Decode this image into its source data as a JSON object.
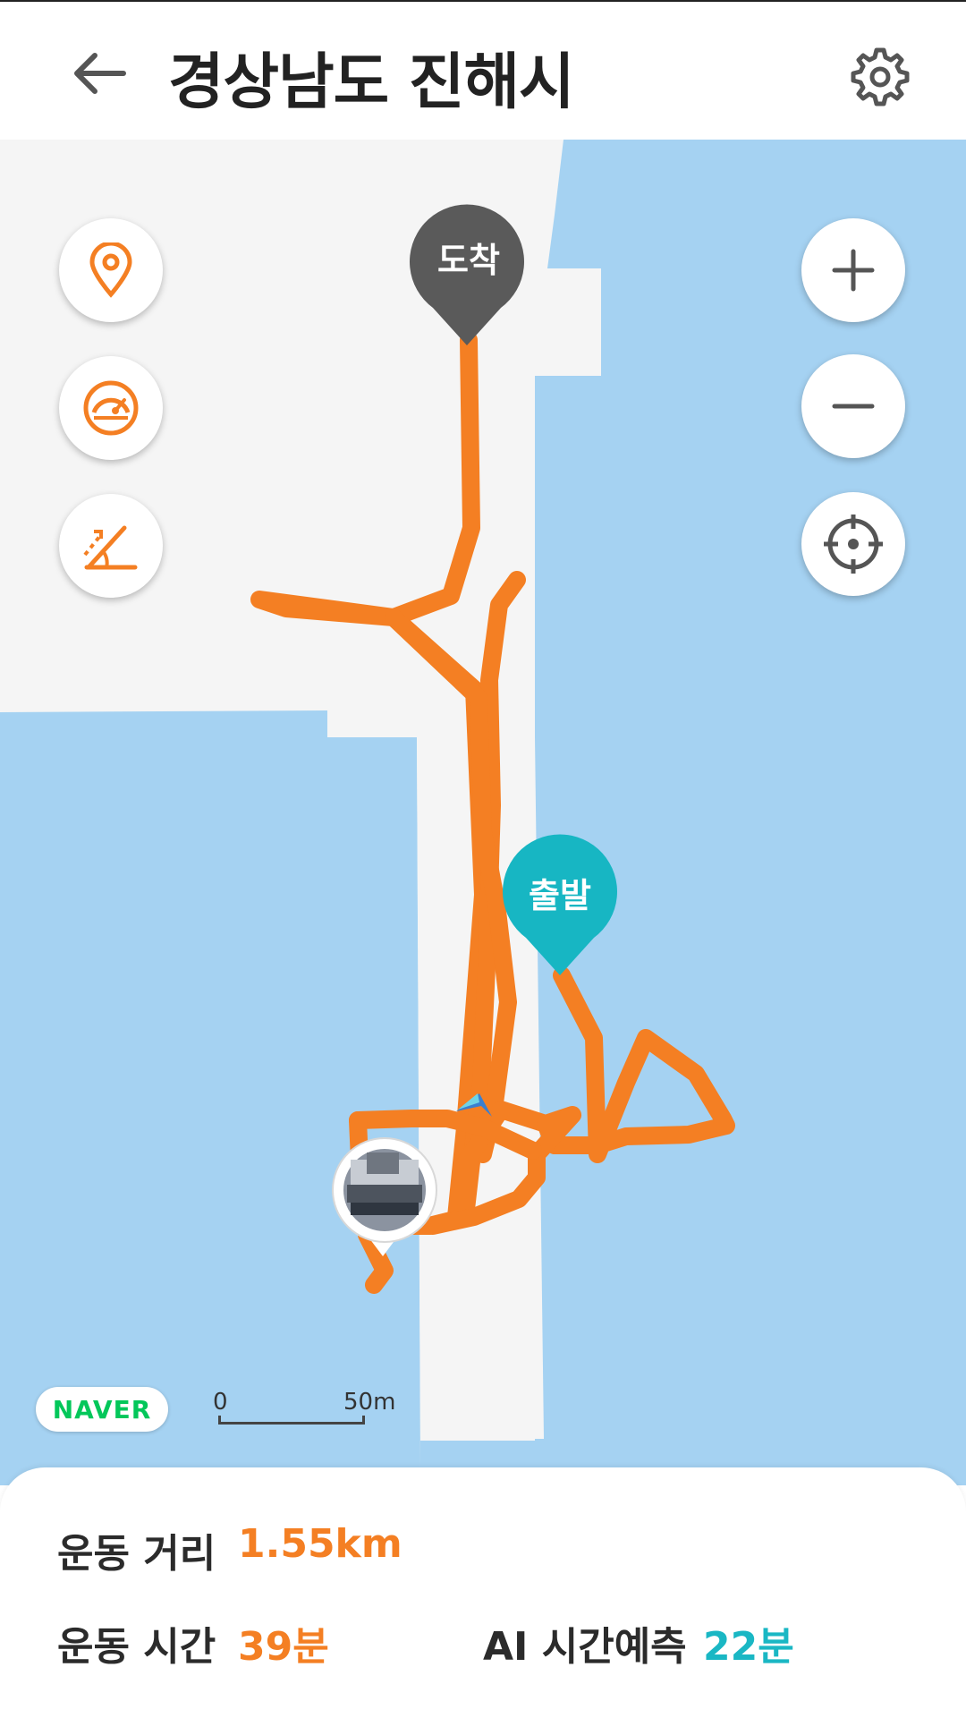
{
  "header": {
    "title": "경상남도 진해시",
    "back_icon": "back-arrow-icon",
    "settings_icon": "gear-icon"
  },
  "map": {
    "left_buttons": [
      "location-pin-icon",
      "speedometer-icon",
      "slope-icon"
    ],
    "right_buttons": [
      "plus-icon",
      "minus-icon",
      "crosshair-icon"
    ],
    "markers": {
      "end_label": "도착",
      "start_label": "출발"
    },
    "provider_logo": "NAVER",
    "scale": {
      "zero": "0",
      "distance": "50m"
    },
    "colors": {
      "water": "#a5d2f2",
      "land": "#f5f5f5",
      "route": "#f47f23",
      "end_marker": "#5a5a5a",
      "start_marker": "#17b6c3"
    }
  },
  "stats": {
    "distance_label": "운동 거리",
    "distance_value": "1.55km",
    "time_label": "운동 시간",
    "time_value": "39분",
    "ai_label": "AI 시간예측",
    "ai_value": "22분"
  }
}
